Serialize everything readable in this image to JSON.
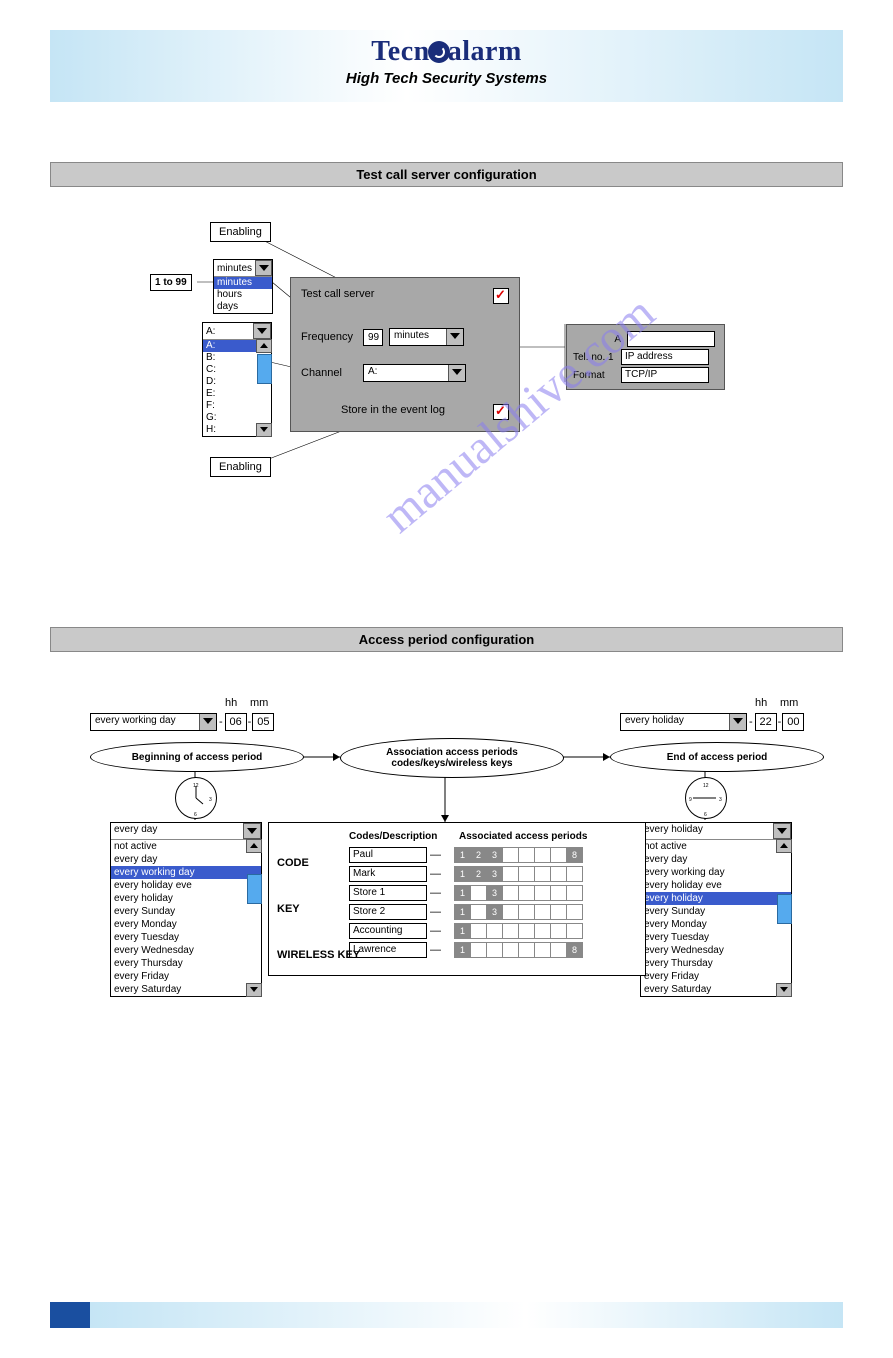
{
  "header": {
    "logo_left": "Tecn",
    "logo_right": "alarm",
    "tagline": "High Tech Security Systems"
  },
  "section1": {
    "title": "Test call server configuration",
    "callout_enabling_top": "Enabling",
    "callout_enabling_bottom": "Enabling",
    "range_label": "1 to 99",
    "unit_select_selected": "minutes",
    "unit_select_options": [
      "minutes",
      "minutes",
      "hours",
      "days"
    ],
    "channel_list_selected": "A:",
    "channel_list_options": [
      "A:",
      "A:",
      "B:",
      "C:",
      "D:",
      "E:",
      "F:",
      "G:",
      "H:"
    ],
    "panel": {
      "test_call_label": "Test call server",
      "frequency_label": "Frequency",
      "frequency_value": "99",
      "frequency_unit": "minutes",
      "channel_label": "Channel",
      "channel_value": "A:",
      "store_label": "Store in the event log"
    },
    "side": {
      "letter": "A",
      "tel_label": "Tel. no. 1",
      "tel_value": "IP address",
      "format_label": "Format",
      "format_value": "TCP/IP"
    }
  },
  "section2": {
    "title": "Access period configuration",
    "hh_label": "hh",
    "mm_label": "mm",
    "begin": {
      "select_value": "every working day",
      "hh": "06",
      "mm": "05",
      "oval": "Beginning of access period",
      "list_head": "every day",
      "list_options": [
        "not active",
        "every day",
        "every working day",
        "every holiday eve",
        "every holiday",
        "every Sunday",
        "every Monday",
        "every Tuesday",
        "every Wednesday",
        "every Thursday",
        "every Friday",
        "every Saturday"
      ],
      "list_selected_index": 2
    },
    "center_oval_line1": "Association access periods",
    "center_oval_line2": "codes/keys/wireless keys",
    "end": {
      "select_value": "every holiday",
      "hh": "22",
      "mm": "00",
      "oval": "End of access period",
      "list_head": "every holiday",
      "list_options": [
        "not active",
        "every day",
        "every working day",
        "every holiday eve",
        "every holiday",
        "every Sunday",
        "every Monday",
        "every Tuesday",
        "every Wednesday",
        "every Thursday",
        "every Friday",
        "every Saturday"
      ],
      "list_selected_index": 4
    },
    "assoc": {
      "col_codes": "Codes/Description",
      "col_periods": "Associated access periods",
      "cat_code": "CODE",
      "cat_key": "KEY",
      "cat_wireless": "WIRELESS KEY",
      "rows": [
        {
          "name": "Paul",
          "on": [
            1,
            2,
            3,
            8
          ]
        },
        {
          "name": "Mark",
          "on": [
            1,
            2,
            3
          ]
        },
        {
          "name": "Store 1",
          "on": [
            1,
            3
          ]
        },
        {
          "name": "Store 2",
          "on": [
            1,
            3
          ]
        },
        {
          "name": "Accounting",
          "on": [
            1
          ]
        },
        {
          "name": "Lawrence",
          "on": [
            1,
            8
          ]
        }
      ]
    }
  },
  "watermark": "manualshive.com"
}
